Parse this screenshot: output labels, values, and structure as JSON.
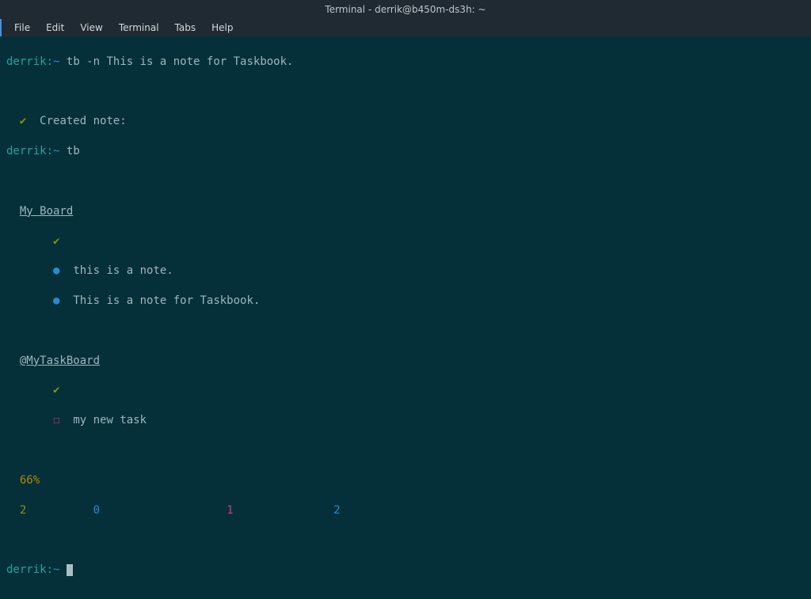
{
  "window": {
    "title": "Terminal - derrik@b450m-ds3h: ~"
  },
  "menu": {
    "file": "File",
    "edit": "Edit",
    "view": "View",
    "terminal": "Terminal",
    "tabs": "Tabs",
    "help": "Help"
  },
  "term": {
    "prompt1": "derrik:",
    "pathsym": "~",
    "cmd1": "tb -n This is a note for Taskbook.",
    "check": "✔",
    "created": "Created note:",
    "cmd2": "tb",
    "board1": "My Board",
    "note1": "this is a note.",
    "note2": "This is a note for Taskbook.",
    "board2": "@MyTaskBoard",
    "task1": "my new task",
    "pct": "66%",
    "s_done": "2",
    "s_pending": "0",
    "s_inprog": "1",
    "s_notes": "2",
    "bullet": "●",
    "box": "☐"
  }
}
